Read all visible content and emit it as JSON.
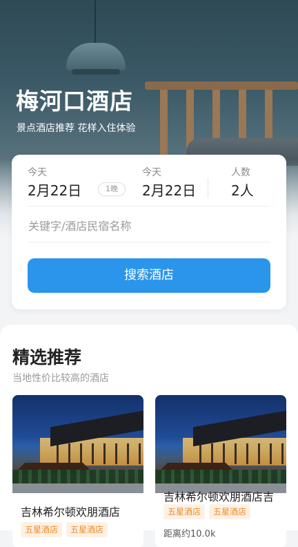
{
  "hero": {
    "title": "梅河口酒店",
    "subtitle": "景点酒店推荐 花样入住体验"
  },
  "search": {
    "checkin_label": "今天",
    "checkin_date": "2月22日",
    "nights": "1晚",
    "checkout_label": "今天",
    "checkout_date": "2月22日",
    "guests_label": "人数",
    "guests_value": "2人",
    "keyword_placeholder": "关键字/酒店民宿名称",
    "button_label": "搜索酒店",
    "button_color": "#2b95ec"
  },
  "recommend": {
    "title": "精选推荐",
    "subtitle": "当地性价比较高的酒店",
    "hotels": [
      {
        "name": "吉林希尔顿欢朋酒店",
        "tags": [
          "五星酒店",
          "五星酒店"
        ],
        "distance": ""
      },
      {
        "name": "吉林希尔顿欢朋酒店吉",
        "tags": [
          "五星酒店",
          "五星酒店"
        ],
        "distance": "距离约10.0k"
      }
    ]
  },
  "colors": {
    "accent": "#2b95ec",
    "tag_text": "#f08a24",
    "tag_bg": "#fdf1e6"
  }
}
